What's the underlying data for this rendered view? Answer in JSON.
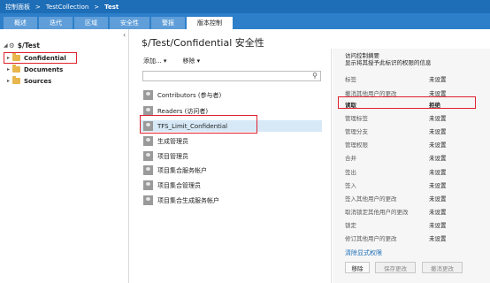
{
  "breadcrumb": [
    "控制面板",
    "TestCollection",
    "Test"
  ],
  "tabs": [
    "概述",
    "迭代",
    "区域",
    "安全性",
    "警报",
    "版本控制"
  ],
  "tree": {
    "root": "$/Test",
    "items": [
      "Confidential",
      "Documents",
      "Sources"
    ]
  },
  "title": "$/Test/Confidential 安全性",
  "toolbar": {
    "add": "添加...",
    "remove": "移除"
  },
  "search": {
    "placeholder": ""
  },
  "members": [
    "Contributors (参与者)",
    "Readers (访问者)",
    "TFS_Limit_Confidential",
    "生成管理员",
    "项目管理员",
    "项目集合服务帐户",
    "项目集合管理员",
    "项目集合生成服务帐户"
  ],
  "panel": {
    "head_line1": "访问控制摘要",
    "head_line2": "显示将其授予此标识的权限的信息",
    "permissions": [
      {
        "name": "标签",
        "value": "未设置"
      },
      {
        "name": "撤消其他用户的更改",
        "value": "未设置"
      },
      {
        "name": "读取",
        "value": "拒绝"
      },
      {
        "name": "管理标签",
        "value": "未设置"
      },
      {
        "name": "管理分支",
        "value": "未设置"
      },
      {
        "name": "管理权限",
        "value": "未设置"
      },
      {
        "name": "合并",
        "value": "未设置"
      },
      {
        "name": "签出",
        "value": "未设置"
      },
      {
        "name": "签入",
        "value": "未设置"
      },
      {
        "name": "签入其他用户的更改",
        "value": "未设置"
      },
      {
        "name": "取消锁定其他用户的更改",
        "value": "未设置"
      },
      {
        "name": "锁定",
        "value": "未设置"
      },
      {
        "name": "修订其他用户的更改",
        "value": "未设置"
      }
    ],
    "clear_link": "清除显式权限",
    "buttons": {
      "remove": "移除",
      "save": "保存更改",
      "undo": "撤消更改"
    }
  }
}
